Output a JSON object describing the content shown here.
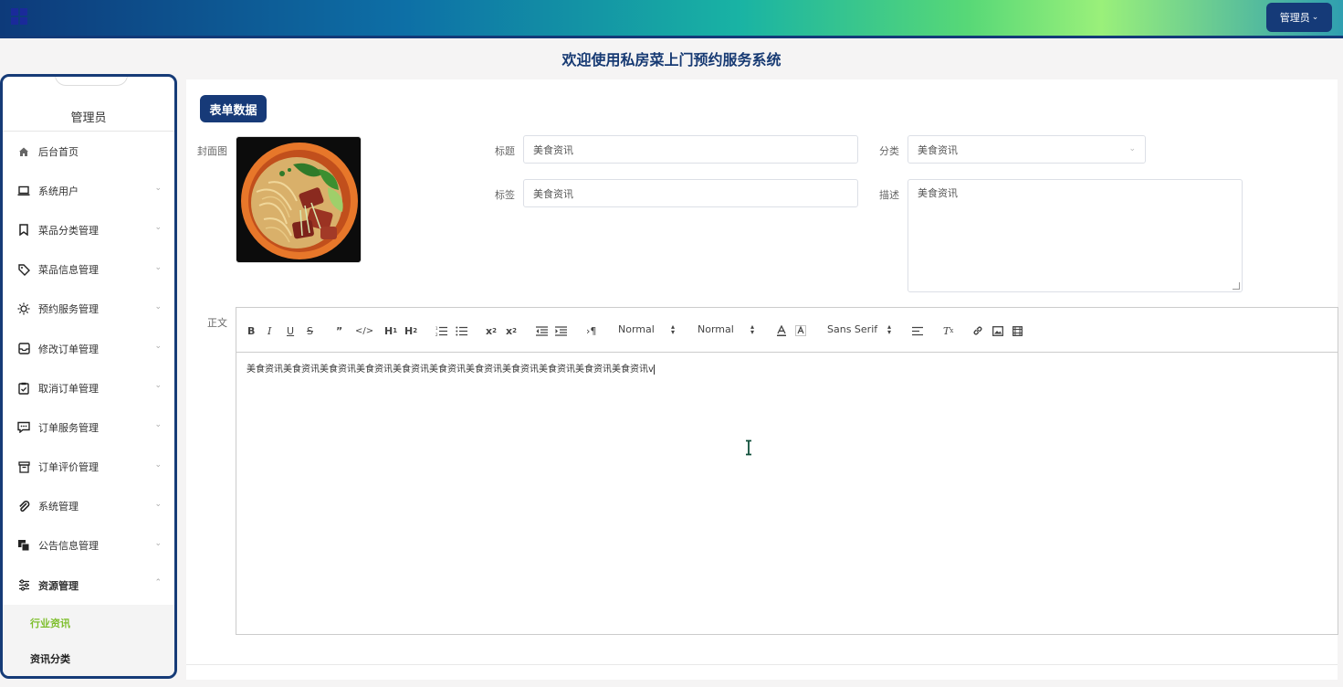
{
  "header": {
    "user_menu_label": "管理员",
    "system_title": "欢迎使用私房菜上门预约服务系统"
  },
  "colors": {
    "primary": "#173a78",
    "active_submenu": "#7dbe2b"
  },
  "sidebar": {
    "user_name": "管理员",
    "items": [
      {
        "label": "后台首页",
        "icon": "home-icon"
      },
      {
        "label": "系统用户",
        "icon": "laptop-icon"
      },
      {
        "label": "菜品分类管理",
        "icon": "bookmark-icon"
      },
      {
        "label": "菜品信息管理",
        "icon": "tag-icon"
      },
      {
        "label": "预约服务管理",
        "icon": "sun-icon"
      },
      {
        "label": "修改订单管理",
        "icon": "inbox-icon"
      },
      {
        "label": "取消订单管理",
        "icon": "clipboard-check-icon"
      },
      {
        "label": "订单服务管理",
        "icon": "chat-icon"
      },
      {
        "label": "订单评价管理",
        "icon": "archive-icon"
      },
      {
        "label": "系统管理",
        "icon": "paperclip-icon"
      },
      {
        "label": "公告信息管理",
        "icon": "copy-icon"
      },
      {
        "label": "资源管理",
        "icon": "sliders-icon"
      }
    ],
    "subitems": [
      {
        "label": "行业资讯",
        "active": true
      },
      {
        "label": "资讯分类",
        "active": false
      }
    ]
  },
  "form": {
    "tab_label": "表单数据",
    "cover_label": "封面图",
    "title_label": "标题",
    "title_value": "美食资讯",
    "category_label": "分类",
    "category_value": "美食资讯",
    "tags_label": "标签",
    "tags_value": "美食资讯",
    "desc_label": "描述",
    "desc_value": "美食资讯",
    "body_label": "正文",
    "editor": {
      "header_select": "Normal",
      "size_select": "Normal",
      "font_select": "Sans Serif",
      "content": "美食资讯美食资讯美食资讯美食资讯美食资讯美食资讯美食资讯美食资讯美食资讯美食资讯美食资讯v"
    }
  }
}
